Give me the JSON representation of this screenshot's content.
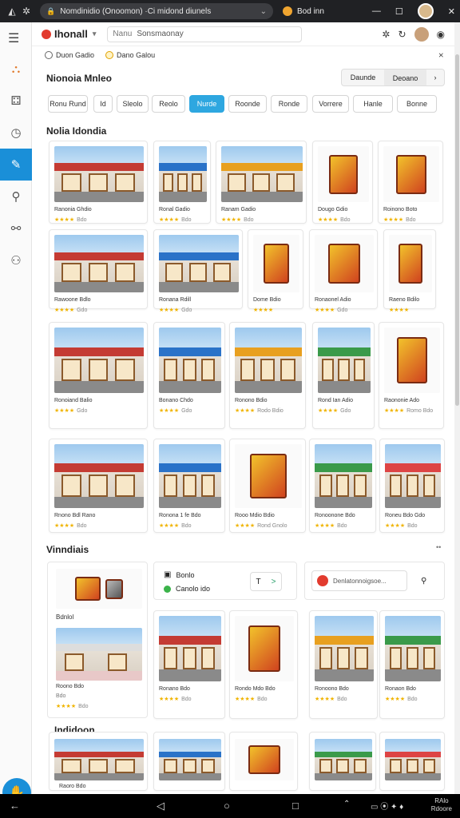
{
  "browser": {
    "url_text": "Nomdinidio (Onoomon) ·Ci midond diunels",
    "tab_title": "Bod inn"
  },
  "header": {
    "logo_text": "Ihonall",
    "search_prefix": "Nanu",
    "search_value": "Sonsmaonay"
  },
  "subbar": {
    "chip1": "Duon Gadio",
    "chip2": "Dano Galou"
  },
  "section1": {
    "title": "Nionoia Mnleo",
    "sort_options": [
      "Daunde",
      "Deoano"
    ],
    "filters": [
      {
        "label": "Ronu Rund",
        "active": false
      },
      {
        "label": "Id",
        "active": false
      },
      {
        "label": "Sleolo",
        "active": false
      },
      {
        "label": "Reolo",
        "active": false
      },
      {
        "label": "Nurde",
        "active": true
      },
      {
        "label": "Roonde",
        "active": false
      },
      {
        "label": "Ronde",
        "active": false
      },
      {
        "label": "Vorrere",
        "active": false
      },
      {
        "label": "Hanle",
        "active": false
      },
      {
        "label": "Bonne",
        "active": false
      }
    ]
  },
  "section2": {
    "title": "Nolia Idondia"
  },
  "cards_row1": [
    {
      "title": "Ranonia Ghdio",
      "rating": "Bdo"
    },
    {
      "title": "Ronal Gadio",
      "rating": "Bdo"
    },
    {
      "title": "Ranam Gadio",
      "rating": "Bdo"
    },
    {
      "title": "Dougo Gdio",
      "rating": "Bdo"
    },
    {
      "title": "Roinono Boto",
      "rating": "Bdo"
    }
  ],
  "cards_row2": [
    {
      "title": "Rawoone Bdlo",
      "rating": "Gdo"
    },
    {
      "title": "Ronana Rdill",
      "rating": "Gdo"
    },
    {
      "title": "Dome Bdio",
      "rating": ""
    },
    {
      "title": "Ronaonel Adio",
      "rating": "Gdo"
    },
    {
      "title": "Raeno Bdilo",
      "rating": ""
    }
  ],
  "cards_row3": [
    {
      "title": "Ronoiand Balio",
      "rating": "Gdo"
    },
    {
      "title": "Bonano Chdo",
      "rating": "Gdo"
    },
    {
      "title": "Ronono Bdio",
      "rating": "Rodo Bdio"
    },
    {
      "title": "Rond Ian Adio",
      "rating": "Gdo"
    },
    {
      "title": "Raononie Ado",
      "rating": "Romo Bdo"
    }
  ],
  "cards_row4": [
    {
      "title": "Rnono Bdl Rano",
      "rating": "Bdo"
    },
    {
      "title": "Ronona 1 fe Bdo",
      "rating": "Bdo"
    },
    {
      "title": "Rooo Mdio Bdio",
      "rating": "Rond Gnolo"
    },
    {
      "title": "Ronoonone Bdo",
      "rating": "Bdo"
    },
    {
      "title": "Roneu Bdo Gdo",
      "rating": "Bdo"
    }
  ],
  "section3": {
    "title": "Vinndiais"
  },
  "panel_left": {
    "label": "Bdnlol"
  },
  "panel_mid": {
    "item1": "Bonlo",
    "item2": "Canolo ido",
    "nav_left": "T",
    "nav_right": ">"
  },
  "panel_search": {
    "placeholder": "Denlatonnoigsoe..."
  },
  "cards_row5": [
    {
      "title": "Roono Bdo",
      "rating": "Bdo"
    },
    {
      "title": "Ronano Bdo",
      "rating": "Bdo"
    },
    {
      "title": "Rondo Mdo Bdo",
      "rating": "Bdo"
    },
    {
      "title": "Ronoono Bdo",
      "rating": "Bdo"
    },
    {
      "title": "Ronaon Bdo",
      "rating": "Bdo"
    }
  ],
  "section4": {
    "title": "Indidoon"
  },
  "footer_card": {
    "title": "Raoro Bdo"
  },
  "status": {
    "time": "RAlo",
    "date": "Rdoore"
  },
  "colors": {
    "accent": "#1a8fd8",
    "pill_active": "#2ea7e0",
    "star": "#f0b400",
    "brand": "#e23b2e"
  }
}
